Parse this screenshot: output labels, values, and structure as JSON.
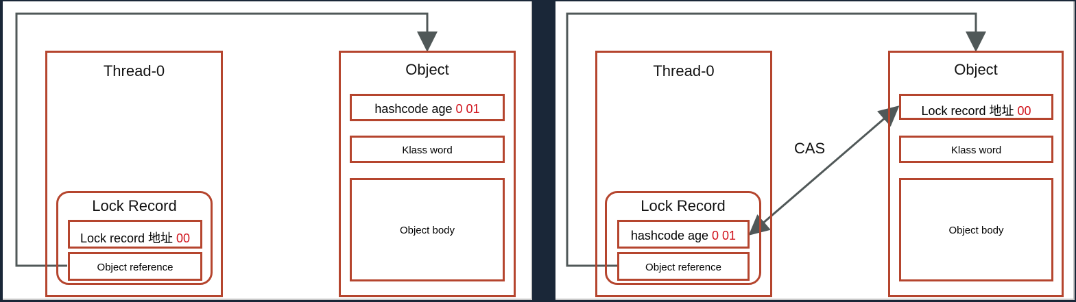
{
  "colors": {
    "box_border": "#b5452e",
    "arrow": "#505858",
    "highlight_text": "#d0121b"
  },
  "left": {
    "thread_title": "Thread-0",
    "lock_record_title": "Lock Record",
    "lock_record_field": {
      "text": "Lock record 地址",
      "value": "00"
    },
    "object_reference": "Object reference",
    "object_title": "Object",
    "mark_word": {
      "text": "hashcode age",
      "value": "0 01"
    },
    "klass_word": "Klass word",
    "object_body": "Object body"
  },
  "right": {
    "thread_title": "Thread-0",
    "lock_record_title": "Lock Record",
    "lock_record_field": {
      "text": "hashcode age",
      "value": "0 01"
    },
    "object_reference": "Object reference",
    "object_title": "Object",
    "mark_word": {
      "text": "Lock record 地址",
      "value": "00"
    },
    "klass_word": "Klass word",
    "object_body": "Object body",
    "cas_label": "CAS"
  }
}
